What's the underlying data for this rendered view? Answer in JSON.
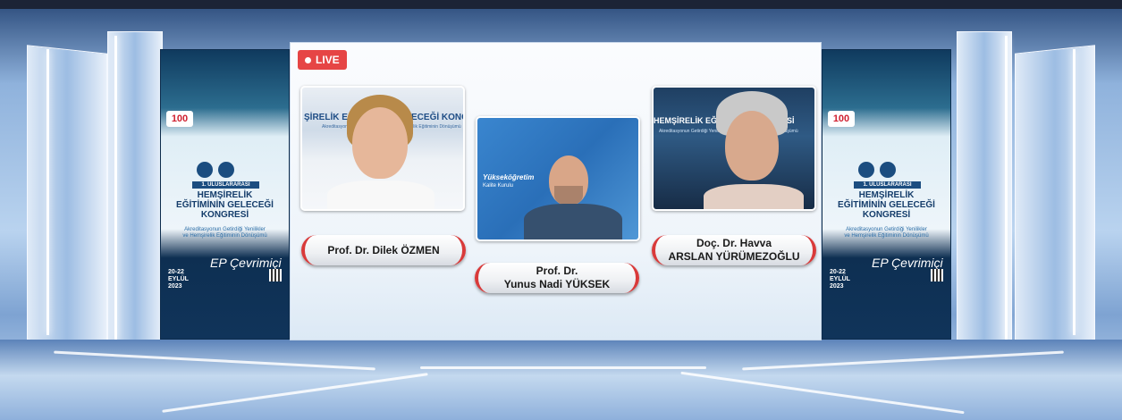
{
  "live_label": "LIVE",
  "tiles": {
    "left": {
      "banner": "ŞİRELİK EĞİTİMİNİN GELECEĞİ KONGRESİ",
      "banner_sub": "Akreditasyonun Getirdiği Yenilikler ve Hemşirelik Eğitiminin Dönüşümü"
    },
    "center": {
      "banner": "Yükseköğretim",
      "banner_sub": "Kalite Kurulu"
    },
    "right": {
      "banner": "HEMŞİRELİK EĞİTİMİNİN KONGRESİ",
      "banner_sub": "Akreditasyonun Getirdiği Yenilikler ve Hemşirelik Eğitiminin Dönüşümü"
    }
  },
  "speakers": {
    "left": {
      "line1": "Prof. Dr. Dilek ÖZMEN",
      "line2": ""
    },
    "center": {
      "line1": "Prof. Dr.",
      "line2": "Yunus Nadi YÜKSEK"
    },
    "right": {
      "line1": "Doç. Dr. Havva",
      "line2": "ARSLAN YÜRÜMEZOĞLU"
    }
  },
  "side_banner": {
    "badge": "100",
    "tag": "1. ULUSLARARASI",
    "title": "HEMŞİRELİK\nEĞİTİMİNİN GELECEĞİ\nKONGRESİ",
    "subtitle": "Akreditasyonun Getirdiği Yenilikler\nve Hemşirelik Eğitiminin Dönüşümü",
    "ep": "EP Çevrimiçi",
    "dates": "20-22\nEYLÜL\n2023"
  },
  "colors": {
    "accent_red": "#d93a3a",
    "live_red": "#e64545",
    "navy": "#153d6b"
  }
}
